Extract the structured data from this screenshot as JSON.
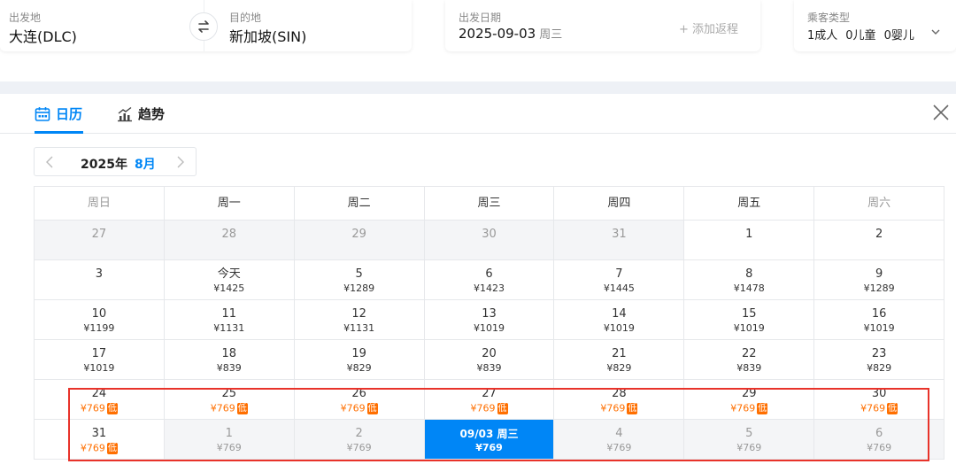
{
  "search": {
    "from_label": "出发地",
    "from_value": "大连(DLC)",
    "to_label": "目的地",
    "to_value": "新加坡(SIN)",
    "date_label": "出发日期",
    "date_value": "2025-09-03",
    "date_weekday": "周三",
    "add_return": "+ 添加返程",
    "pax_label": "乘客类型",
    "pax_adult": "1成人",
    "pax_child": "0儿童",
    "pax_infant": "0婴儿"
  },
  "tabs": {
    "calendar": "日历",
    "trend": "趋势"
  },
  "month_nav": {
    "year": "2025年",
    "month": "8月"
  },
  "colors": {
    "accent": "#0086f6",
    "low_price": "#ff6f00",
    "highlight_box": "#e8332a"
  },
  "calendar": {
    "weekdays": [
      "周日",
      "周一",
      "周二",
      "周三",
      "周四",
      "周五",
      "周六"
    ],
    "low_tag": "低",
    "rows": [
      [
        {
          "day": "27",
          "price": "",
          "state": "muted"
        },
        {
          "day": "28",
          "price": "",
          "state": "muted"
        },
        {
          "day": "29",
          "price": "",
          "state": "muted"
        },
        {
          "day": "30",
          "price": "",
          "state": "muted"
        },
        {
          "day": "31",
          "price": "",
          "state": "muted"
        },
        {
          "day": "1",
          "price": "",
          "state": ""
        },
        {
          "day": "2",
          "price": "",
          "state": ""
        }
      ],
      [
        {
          "day": "3",
          "price": "",
          "state": ""
        },
        {
          "day": "今天",
          "price": "¥1425",
          "state": ""
        },
        {
          "day": "5",
          "price": "¥1289",
          "state": ""
        },
        {
          "day": "6",
          "price": "¥1423",
          "state": ""
        },
        {
          "day": "7",
          "price": "¥1445",
          "state": ""
        },
        {
          "day": "8",
          "price": "¥1478",
          "state": ""
        },
        {
          "day": "9",
          "price": "¥1289",
          "state": ""
        }
      ],
      [
        {
          "day": "10",
          "price": "¥1199",
          "state": ""
        },
        {
          "day": "11",
          "price": "¥1131",
          "state": ""
        },
        {
          "day": "12",
          "price": "¥1131",
          "state": ""
        },
        {
          "day": "13",
          "price": "¥1019",
          "state": ""
        },
        {
          "day": "14",
          "price": "¥1019",
          "state": ""
        },
        {
          "day": "15",
          "price": "¥1019",
          "state": ""
        },
        {
          "day": "16",
          "price": "¥1019",
          "state": ""
        }
      ],
      [
        {
          "day": "17",
          "price": "¥1019",
          "state": ""
        },
        {
          "day": "18",
          "price": "¥839",
          "state": ""
        },
        {
          "day": "19",
          "price": "¥829",
          "state": ""
        },
        {
          "day": "20",
          "price": "¥839",
          "state": ""
        },
        {
          "day": "21",
          "price": "¥829",
          "state": ""
        },
        {
          "day": "22",
          "price": "¥839",
          "state": ""
        },
        {
          "day": "23",
          "price": "¥829",
          "state": ""
        }
      ],
      [
        {
          "day": "24",
          "price": "¥769",
          "state": "low"
        },
        {
          "day": "25",
          "price": "¥769",
          "state": "low"
        },
        {
          "day": "26",
          "price": "¥769",
          "state": "low"
        },
        {
          "day": "27",
          "price": "¥769",
          "state": "low"
        },
        {
          "day": "28",
          "price": "¥769",
          "state": "low"
        },
        {
          "day": "29",
          "price": "¥769",
          "state": "low"
        },
        {
          "day": "30",
          "price": "¥769",
          "state": "low"
        }
      ],
      [
        {
          "day": "31",
          "price": "¥769",
          "state": "low"
        },
        {
          "day": "1",
          "price": "¥769",
          "state": "muted"
        },
        {
          "day": "2",
          "price": "¥769",
          "state": "muted"
        },
        {
          "day": "09/03 周三",
          "price": "¥769",
          "state": "selected"
        },
        {
          "day": "4",
          "price": "¥769",
          "state": "muted"
        },
        {
          "day": "5",
          "price": "¥769",
          "state": "muted"
        },
        {
          "day": "6",
          "price": "¥769",
          "state": "muted"
        }
      ]
    ]
  }
}
